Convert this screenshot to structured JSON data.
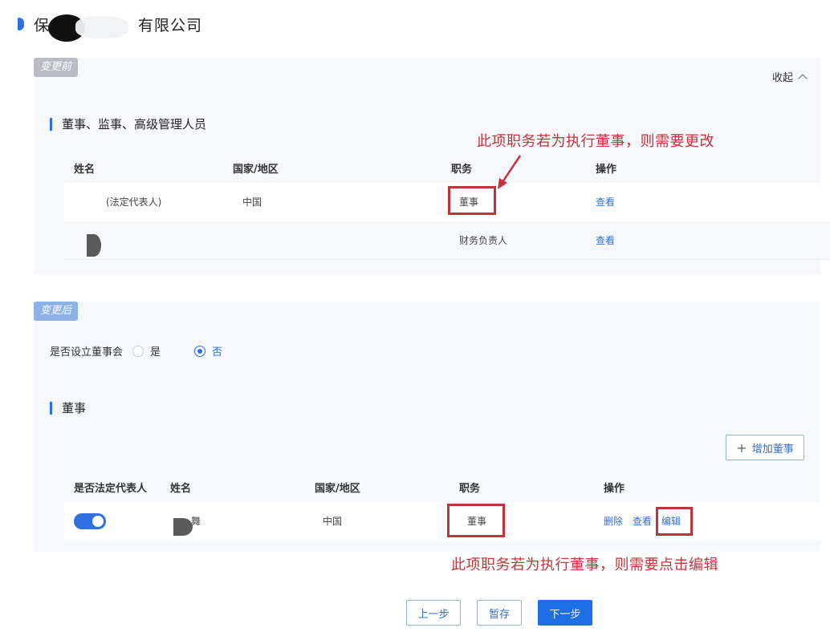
{
  "company": {
    "name_prefix": "保",
    "name_suffix": "有限公司"
  },
  "before": {
    "tag": "变更前",
    "collapse_label": "收起",
    "section_title": "董事、监事、高级管理人员",
    "columns": [
      "姓名",
      "国家/地区",
      "职务",
      "操作"
    ],
    "rows": [
      {
        "name_note": "(法定代表人)",
        "country": "中国",
        "role": "董事",
        "action": "查看"
      },
      {
        "name_note": "",
        "country": "",
        "role": "财务负责人",
        "action": "查看"
      }
    ],
    "annotation": "此项职务若为执行董事，则需要更改"
  },
  "after": {
    "tag": "变更后",
    "board_question": "是否设立董事会",
    "options": [
      {
        "label": "是",
        "selected": false
      },
      {
        "label": "否",
        "selected": true
      }
    ],
    "section_title": "董事",
    "add_button": "增加董事",
    "columns": [
      "是否法定代表人",
      "姓名",
      "国家/地区",
      "职务",
      "操作"
    ],
    "rows": [
      {
        "legal_rep": true,
        "name_tail": "舞",
        "country": "中国",
        "role": "董事",
        "actions": [
          "删除",
          "查看",
          "编辑"
        ]
      }
    ],
    "annotation": "此项职务若为执行董事，则需要点击编辑"
  },
  "footer": {
    "prev": "上一步",
    "save": "暂存",
    "next": "下一步"
  },
  "colors": {
    "accent": "#2f6fe0",
    "annotation_red": "#c0343b",
    "primary_button": "#1e6fe6"
  }
}
